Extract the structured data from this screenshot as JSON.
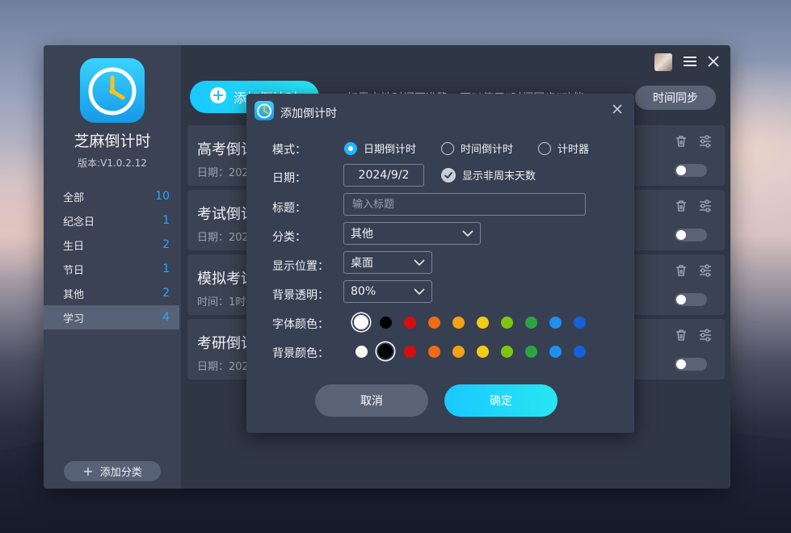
{
  "app": {
    "name": "芝麻倒计时",
    "version": "版本:V1.0.2.12"
  },
  "sidebar": {
    "items": [
      {
        "label": "全部",
        "count": "10"
      },
      {
        "label": "纪念日",
        "count": "1"
      },
      {
        "label": "生日",
        "count": "2"
      },
      {
        "label": "节日",
        "count": "1"
      },
      {
        "label": "其他",
        "count": "2"
      },
      {
        "label": "学习",
        "count": "4",
        "active": true
      }
    ],
    "add_category": "添加分类"
  },
  "toolbar": {
    "add_label": "添加倒计时",
    "notice": "如果本地时间不准确，可以使用“时间同步”功能",
    "sync_label": "时间同步"
  },
  "cards": [
    {
      "title": "高考倒计时",
      "sub": "日期：202"
    },
    {
      "title": "考试倒计时",
      "sub": "日期：202"
    },
    {
      "title": "模拟考试",
      "sub": "时间：1时"
    },
    {
      "title": "考研倒计时",
      "sub": "日期：202"
    }
  ],
  "dialog": {
    "title": "添加倒计时",
    "mode_label": "模式：",
    "modes": [
      "日期倒计时",
      "时间倒计时",
      "计时器"
    ],
    "selected_mode": "日期倒计时",
    "date_label": "日期：",
    "date_value": "2024/9/2",
    "show_non_weekend": "显示非周末天数",
    "show_non_weekend_checked": true,
    "title_label": "标题：",
    "title_placeholder": "输入标题",
    "category_label": "分类：",
    "category_value": "其他",
    "position_label": "显示位置：",
    "position_value": "桌面",
    "opacity_label": "背景透明：",
    "opacity_value": "80%",
    "font_color_label": "字体颜色：",
    "bg_color_label": "背景颜色：",
    "palette": [
      "#ffffff",
      "#000000",
      "#d40f0f",
      "#ef6c14",
      "#f5a312",
      "#f2cc13",
      "#7ec512",
      "#2ca442",
      "#1f8ff0",
      "#1560d8"
    ],
    "font_color_selected": "#ffffff",
    "bg_color_selected": "#000000",
    "cancel": "取消",
    "ok": "确定"
  }
}
